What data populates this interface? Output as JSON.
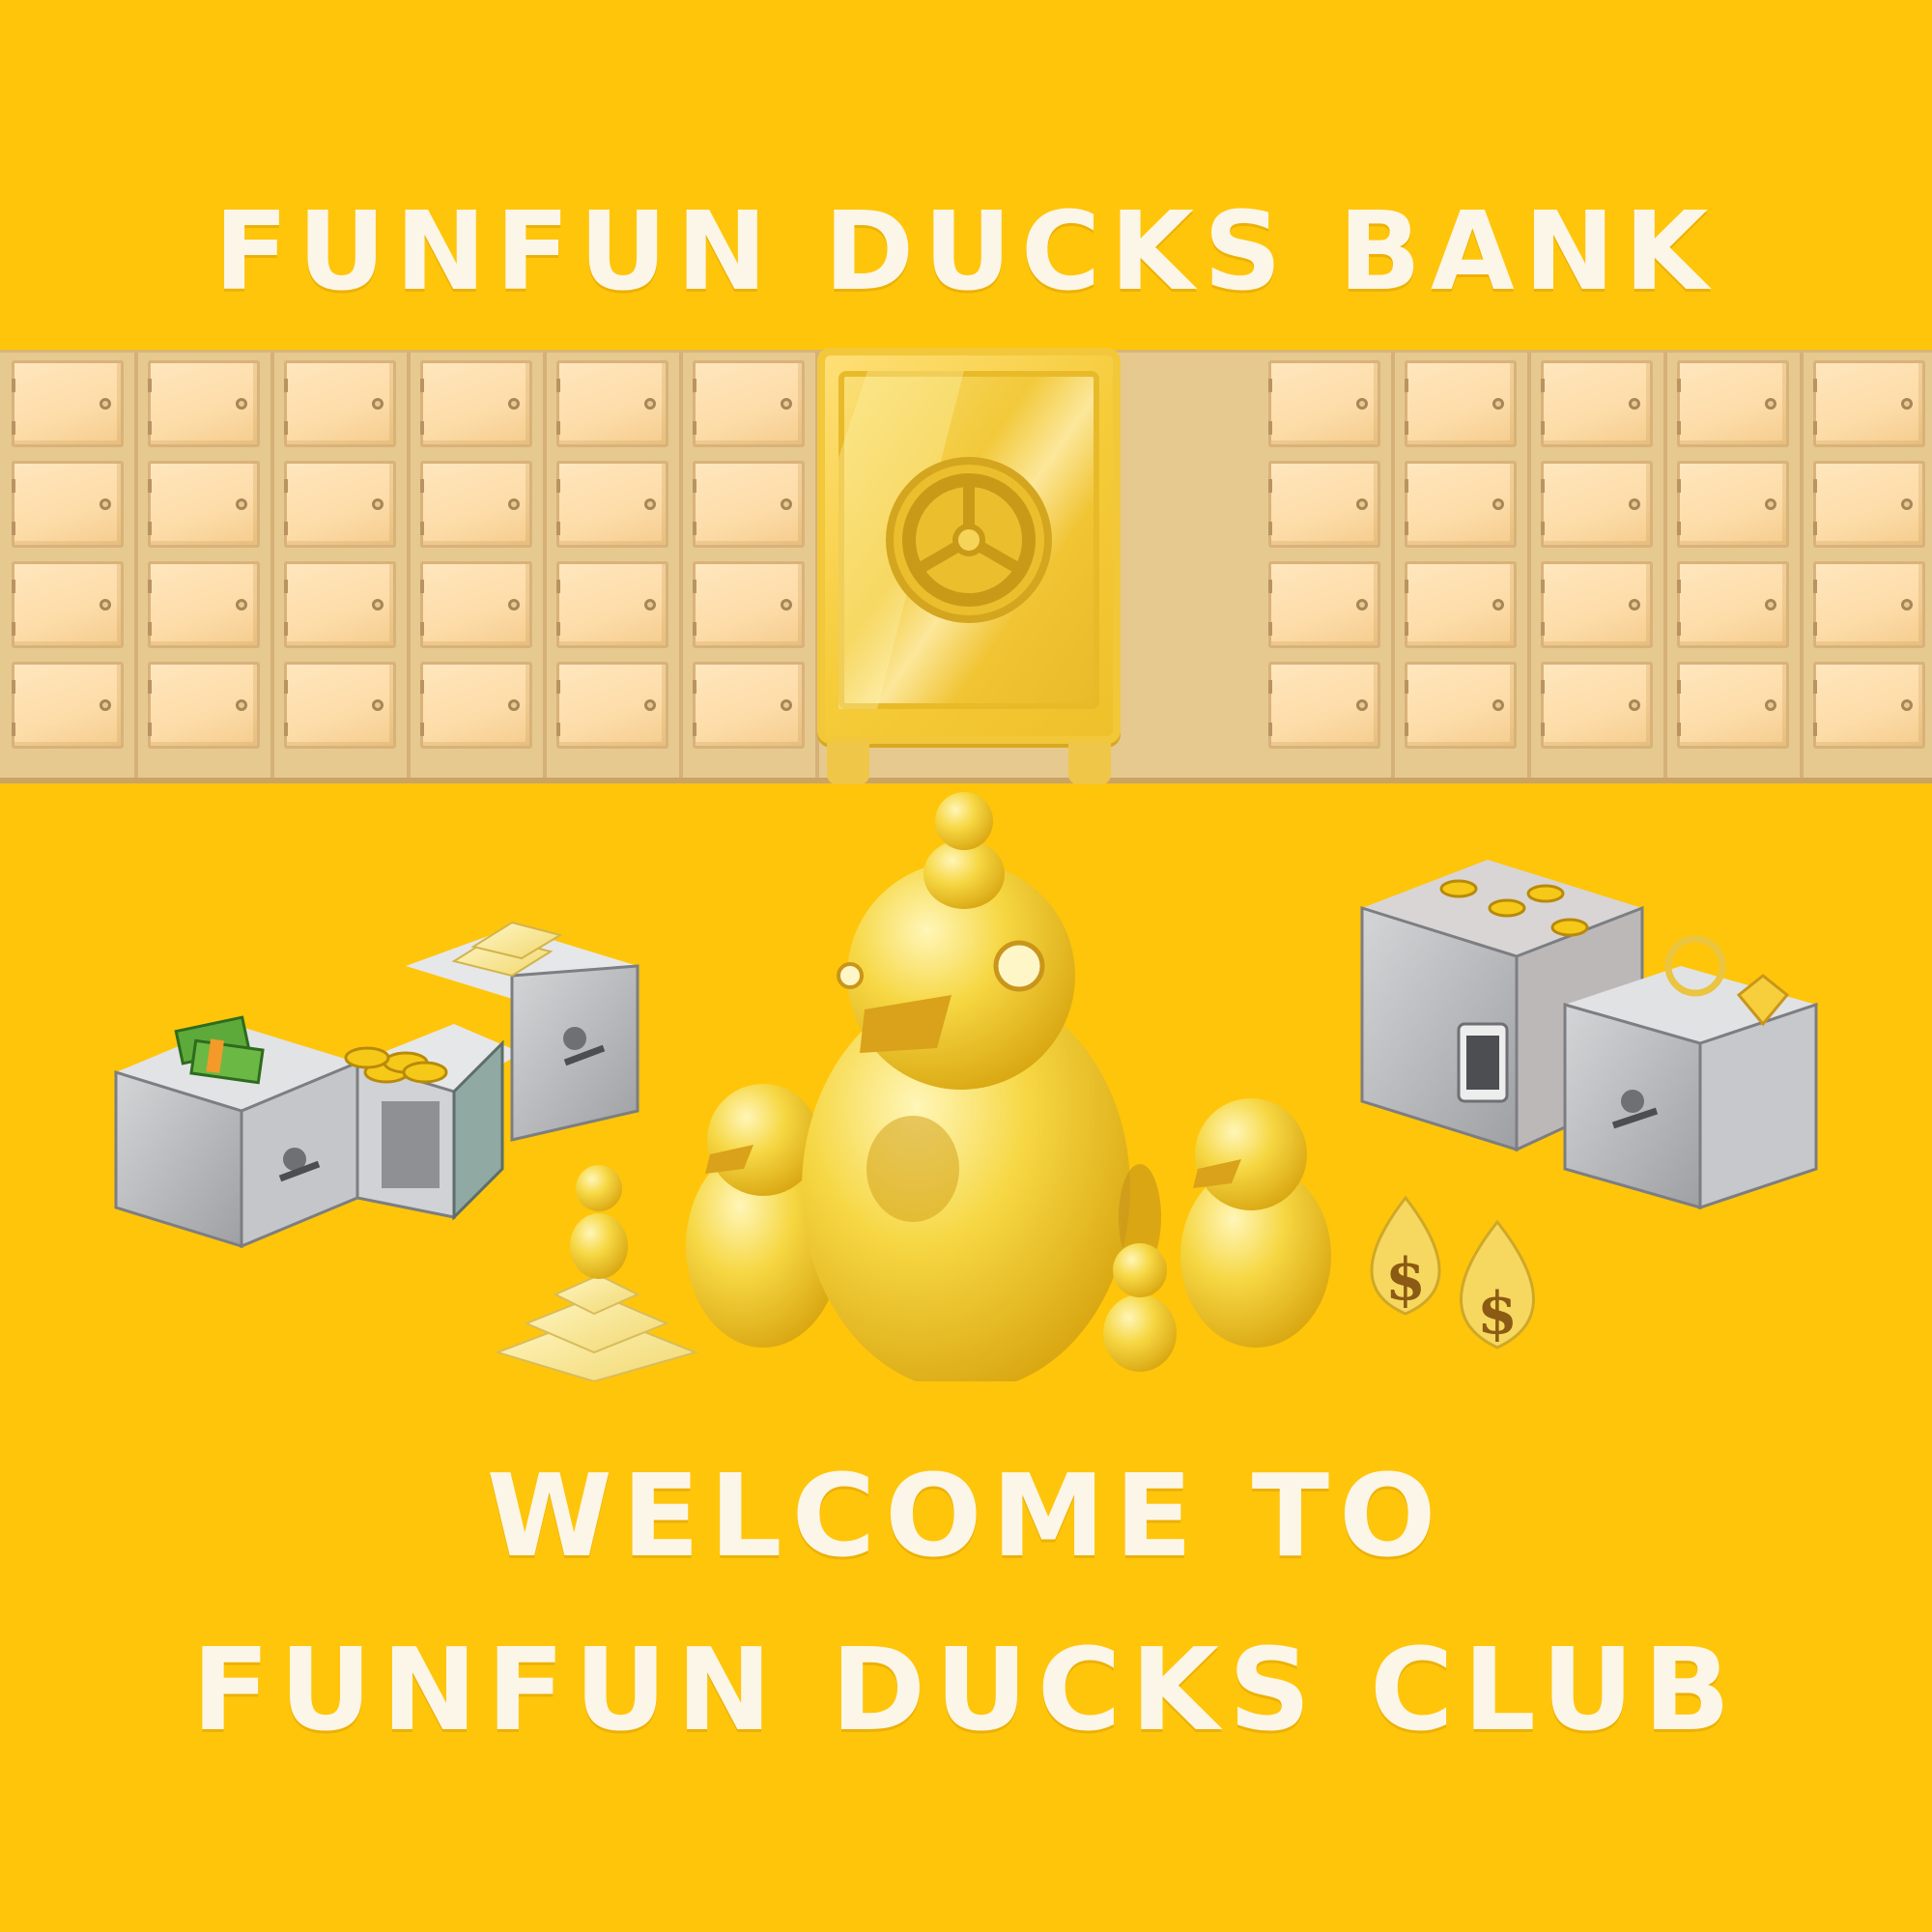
{
  "header": {
    "title": "FUNFUN DUCKS BANK"
  },
  "footer": {
    "line1": "WELCOME TO",
    "line2": "FUNFUN DUCKS CLUB"
  },
  "colors": {
    "background": "#FFC50A",
    "title_text": "#FCF6E8",
    "locker_fill": "#FDDCA8",
    "locker_frame": "#D9B27A",
    "gold_safe": "#F6CC3A",
    "steel_safe": "#B8B9BB"
  },
  "icons": {
    "center_safe": "vault-wheel-icon",
    "left_group": "steel-safe-with-gold-and-cash-icon",
    "right_group": "steel-safe-with-coins-and-jewelry-icon",
    "center_group": "golden-duck-family-icon",
    "money_bag": "dollar-money-bag-icon",
    "gold_bars": "gold-bar-stack-icon"
  },
  "scene": {
    "money_bag_symbol": "$"
  }
}
